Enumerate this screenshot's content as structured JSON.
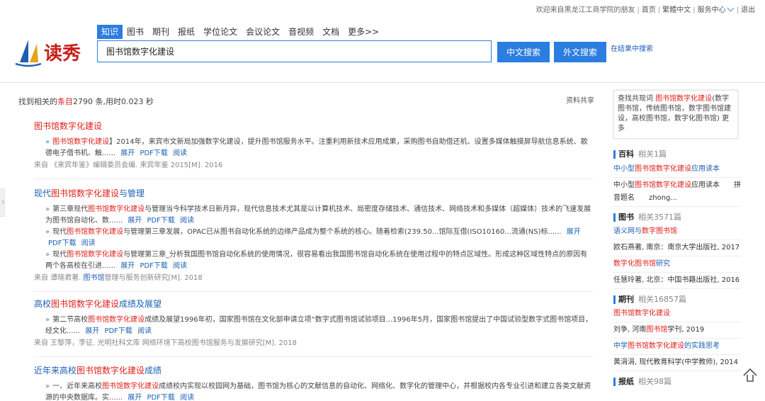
{
  "topbar": {
    "welcome": "欢迎来自黑龙江工商学院的朋友",
    "home": "首页",
    "traditional": "繁體中文",
    "service": "服务中心",
    "logout": "退出"
  },
  "logo": {
    "text": "读秀"
  },
  "tabs": [
    "知识",
    "图书",
    "期刊",
    "报纸",
    "学位论文",
    "会议论文",
    "音视频",
    "文档",
    "更多>>"
  ],
  "search": {
    "value": "图书馆数字化建设",
    "cn_button": "中文搜索",
    "foreign_button": "外文搜索",
    "within": "在结果中搜索"
  },
  "results_info": {
    "prefix": "找到相关的",
    "term": "条目",
    "count": "2790",
    "suffix": " 条,用时0.023 秒"
  },
  "share": "资料共享",
  "results": [
    {
      "title_red": "图书馆数字化建设",
      "title_rest": "",
      "snippets": [
        {
          "red": "图书馆数字化建设",
          "text": "】2014年，来宾市文新局加强数字化建设，提升图书馆服务水平。注重利用新技术应用成果，采购图书自助借还机、设置多媒体触摸屏导航信息系统、歌德电子借书机、触......",
          "pre": "【"
        }
      ],
      "source_pre": "来自 《来宾年鉴》编辑委员会编. 来宾年鉴 2015[M]. 2016",
      "source_red": "",
      "source_post": ""
    },
    {
      "title_pre": "现代",
      "title_red": "图书馆数字化建设",
      "title_rest": "与管理",
      "snippets": [
        {
          "pre": "第三章现代",
          "red": "图书馆数字化建设",
          "text": "与管理当今科学技术日新月异，现代信息技术尤其是以计算机技术、局密度存储技术、通信技术、网络技术和多媒体（超媒体）技术的飞速发展为图书馆自动化、数......"
        },
        {
          "pre": "现代",
          "red": "图书馆数字化建设",
          "text": "与管理第三章发展，OPAC已从图书自动化系统的边缘产品成为整个系统的核心。随着检索(239.50...馆际互借(ISO10160...流通(NS)标......"
        },
        {
          "pre": "现代",
          "red": "图书馆数字化建设",
          "text": "与管理第三章_分析我国图书馆自动化系统的使用情况，很容易看出我国图书馆自动化系统在使用过程中的特点区域性。形成这种区域性特点的原因有两个各高校在引进......"
        }
      ],
      "source_pre": "来自 谭晓君著. ",
      "source_red": "图书馆",
      "source_post": "管理与服务创新研究[M]. 2018"
    },
    {
      "title_pre": "高校",
      "title_red": "图书馆数字化建设",
      "title_rest": "成绩及展望",
      "snippets": [
        {
          "pre": "第二节高校",
          "red": "图书馆数字化建设",
          "text": "成绩及展望1996年初，国家图书馆在文化部申请立项“数字式图书馆试验项目...1996年5月，国家图书馆提出了中国试验型数字式图书馆项目，经文化......"
        }
      ],
      "source_pre": "来自 王黎萍，李征. 光明社科文库 网络环境下高校图书馆服务与发展研究[M]. 2018",
      "source_red": "",
      "source_post": ""
    },
    {
      "title_pre": "近年来高校",
      "title_red": "图书馆数字化建设",
      "title_rest": "成绩",
      "snippets": [
        {
          "pre": "一、近年来高校",
          "red": "图书馆数字化建设",
          "text": "成绩校内实现以校园网为基础，图书馆为核心的文献信息的自动化、网络化、数字化的管理中心，并根据校内各专业引进和建立各类文献资源的中央数据库。实......"
        }
      ],
      "source_pre": "",
      "source_red": "",
      "source_post": ""
    }
  ],
  "actions": {
    "expand": "展开",
    "pdf": "PDF下载",
    "read": "阅读"
  },
  "related_words": {
    "prefix": "查找共现词 ",
    "term": "图书馆数字化建设",
    "list": "(数字图书馆，传统图书馆，数字图书馆建设，高校图书馆，数字化图书馆)",
    "more": "更多"
  },
  "sidebar": {
    "baike": {
      "label": "百科",
      "count": "相关1篇",
      "lines": [
        {
          "pre": "中小型",
          "red": "图书馆数字化建设",
          "post": "应用读本",
          "link": true
        },
        {
          "pre": "中小型",
          "red": "图书馆数字化建设",
          "post": "应用读本　　拼",
          "link": false
        },
        {
          "pre": "音题名　　zhong...",
          "red": "",
          "post": "",
          "link": false
        }
      ]
    },
    "books": {
      "label": "图书",
      "count": "相关3571篇",
      "lines": [
        {
          "pre": "语义网与",
          "red": "数字图书馆",
          "post": "",
          "link": true
        },
        {
          "pre": "欧石燕著, 南京：南京大学出版社, 2017",
          "red": "",
          "post": "",
          "link": false
        },
        {
          "pre": "",
          "red": "数字化图书馆",
          "post": "研究",
          "link": true
        },
        {
          "pre": "任慧玲著, 北京：中国书籍出版社, 2016",
          "red": "",
          "post": "",
          "link": false
        }
      ]
    },
    "journals": {
      "label": "期刊",
      "count": "相关16857篇",
      "lines": [
        {
          "pre": "",
          "red": "图书馆数字化建设",
          "post": "",
          "link": true
        },
        {
          "pre": "刘争, 河南",
          "red": "图书馆",
          "post": "学刊, 2019",
          "link": false
        },
        {
          "pre": "中学",
          "red": "图书馆数字化建设",
          "post": "的实践思考",
          "link": true
        },
        {
          "pre": "黄涓涓, 现代教育科学(中学教师), 2014",
          "red": "",
          "post": "",
          "link": false
        }
      ]
    },
    "newspapers": {
      "label": "报纸",
      "count": "相关98篇"
    }
  },
  "icons": {
    "chevron": "chevron-down-icon",
    "totop": "back-to-top-icon",
    "arrow": "double-chevron-icon"
  }
}
